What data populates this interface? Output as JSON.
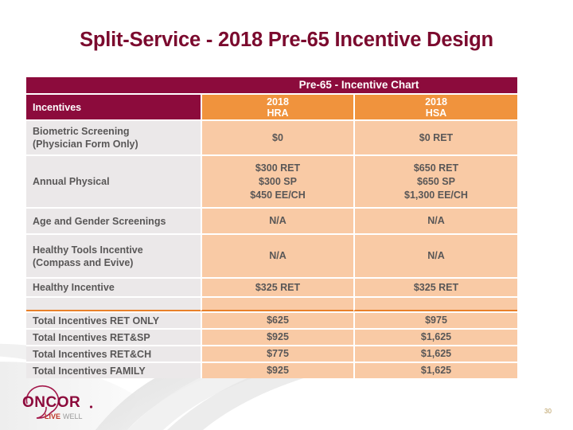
{
  "slide": {
    "title": "Split-Service - 2018 Pre-65 Incentive Design",
    "page_number": "30",
    "title_color": "#7B0A2E",
    "accent_maroon": "#8C0B3C",
    "accent_orange": "#F0933D",
    "cell_orange": "#F9CAA5",
    "cell_gray": "#EBE8E9",
    "rule_orange": "#E8802A"
  },
  "table": {
    "banner": "Pre-65 - Incentive Chart",
    "headers": {
      "label": "Incentives",
      "hra_line1": "2018",
      "hra_line2": "HRA",
      "hsa_line1": "2018",
      "hsa_line2": "HSA"
    },
    "rows": [
      {
        "label_line1": "Biometric Screening",
        "label_line2": "(Physician Form Only)",
        "hra": [
          "$0"
        ],
        "hsa": [
          "$0 RET"
        ]
      },
      {
        "label_line1": "Annual Physical",
        "label_line2": "",
        "hra": [
          "$300 RET",
          "$300 SP",
          "$450 EE/CH"
        ],
        "hsa": [
          "$650 RET",
          "$650 SP",
          "$1,300 EE/CH"
        ]
      },
      {
        "label_line1": "Age and Gender Screenings",
        "label_line2": "",
        "hra": [
          "N/A"
        ],
        "hsa": [
          "N/A"
        ]
      },
      {
        "label_line1": "Healthy Tools Incentive",
        "label_line2": "(Compass and Evive)",
        "hra": [
          "N/A"
        ],
        "hsa": [
          "N/A"
        ]
      },
      {
        "label_line1": "Healthy Incentive",
        "label_line2": "",
        "hra": [
          "$325 RET"
        ],
        "hsa": [
          "$325 RET"
        ]
      }
    ],
    "totals": [
      {
        "label": "Total Incentives RET ONLY",
        "hra": "$625",
        "hsa": "$975"
      },
      {
        "label": "Total Incentives RET&SP",
        "hra": "$925",
        "hsa": "$1,625"
      },
      {
        "label": "Total Incentives RET&CH",
        "hra": "$775",
        "hsa": "$1,625"
      },
      {
        "label": "Total Incentives FAMILY",
        "hra": "$925",
        "hsa": "$1,625"
      }
    ]
  },
  "logo": {
    "brand": "ONCOR",
    "tagline_bold": "LIVE",
    "tagline_light": "WELL"
  }
}
